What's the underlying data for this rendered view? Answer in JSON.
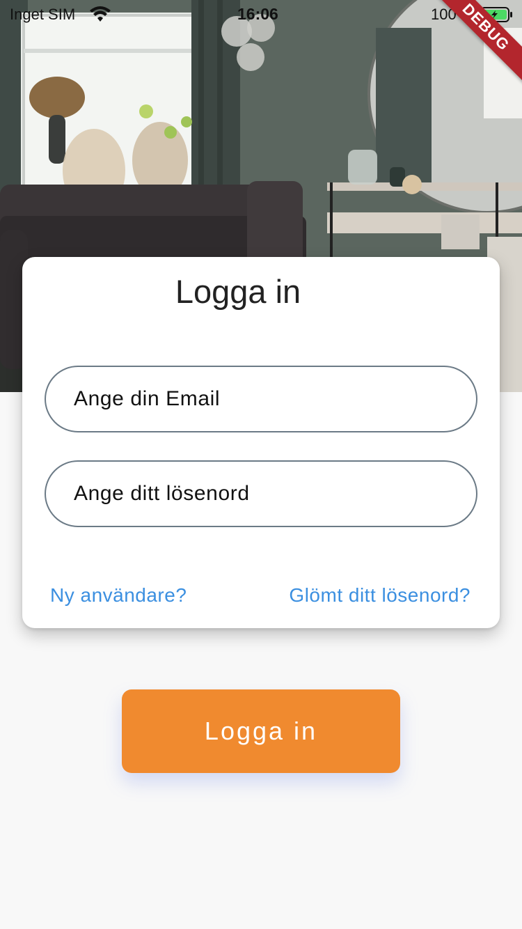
{
  "status_bar": {
    "carrier": "Inget SIM",
    "time": "16:06",
    "battery_percent": "100 %"
  },
  "debug_banner": "DEBUG",
  "login_card": {
    "title": "Logga in",
    "email_placeholder": "Ange din Email",
    "password_placeholder": "Ange ditt lösenord",
    "new_user_link": "Ny användare?",
    "forgot_password_link": "Glömt ditt lösenord?"
  },
  "login_button": "Logga in",
  "icons": {
    "wifi": "wifi-icon",
    "battery": "battery-icon"
  },
  "colors": {
    "accent_button": "#f08a2f",
    "link": "#3b8fe0",
    "field_border": "#6b7a86",
    "debug_ribbon": "#b3262d"
  }
}
